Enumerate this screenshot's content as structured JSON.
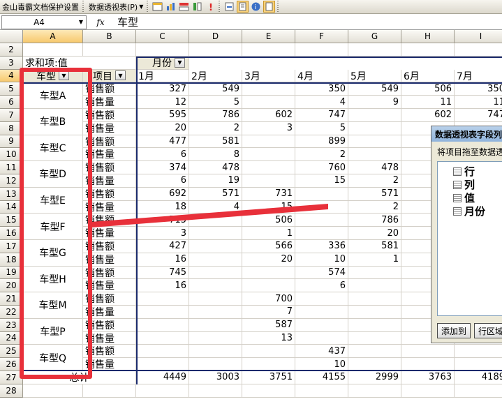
{
  "toolbar": {
    "protect_label": "金山毒霸文档保护设置",
    "pivot_menu_label": "数据透视表(P)",
    "icons": [
      "pivot-report-icon",
      "pivot-chart-icon",
      "insert-row-icon",
      "insert-col-icon",
      "error-icon",
      "refresh-icon",
      "field-list-icon",
      "info-icon",
      "hide-details-icon"
    ]
  },
  "formula_bar": {
    "cell_ref": "A4",
    "fx": "fx",
    "value": "车型"
  },
  "columns": [
    "A",
    "B",
    "C",
    "D",
    "E",
    "F",
    "G",
    "H",
    "I"
  ],
  "rows": [
    "2",
    "3",
    "4",
    "5",
    "6",
    "7",
    "8",
    "9",
    "10",
    "11",
    "12",
    "13",
    "14",
    "15",
    "16",
    "17",
    "18",
    "19",
    "20",
    "21",
    "22",
    "23",
    "24",
    "25",
    "26",
    "27",
    "28"
  ],
  "pivot": {
    "sum_label": "求和项:值",
    "month_field": "月份",
    "row_field": "车型",
    "item_field": "项目",
    "months": [
      "1月",
      "2月",
      "3月",
      "4月",
      "5月",
      "6月",
      "7月"
    ],
    "sales_amount": "销售额",
    "sales_qty": "销售量",
    "models": [
      {
        "name": "车型A",
        "amount": [
          "327",
          "549",
          "",
          "350",
          "549",
          "506",
          "350"
        ],
        "qty": [
          "12",
          "5",
          "",
          "4",
          "9",
          "11",
          "11"
        ]
      },
      {
        "name": "车型B",
        "amount": [
          "595",
          "786",
          "602",
          "747",
          "",
          "602",
          "747"
        ],
        "qty": [
          "20",
          "2",
          "3",
          "5",
          "",
          "",
          ""
        ]
      },
      {
        "name": "车型C",
        "amount": [
          "477",
          "581",
          "",
          "899",
          "",
          "",
          ""
        ],
        "qty": [
          "6",
          "8",
          "",
          "2",
          "",
          "",
          ""
        ]
      },
      {
        "name": "车型D",
        "amount": [
          "374",
          "478",
          "",
          "760",
          "478",
          "",
          ""
        ],
        "qty": [
          "6",
          "19",
          "",
          "15",
          "2",
          "",
          ""
        ]
      },
      {
        "name": "车型E",
        "amount": [
          "692",
          "571",
          "731",
          "",
          "571",
          "",
          ""
        ],
        "qty": [
          "18",
          "4",
          "15",
          "",
          "2",
          "",
          ""
        ]
      },
      {
        "name": "车型F",
        "amount": [
          "715",
          "",
          "506",
          "",
          "786",
          "",
          ""
        ],
        "qty": [
          "3",
          "",
          "1",
          "",
          "20",
          "",
          ""
        ]
      },
      {
        "name": "车型G",
        "amount": [
          "427",
          "",
          "566",
          "336",
          "581",
          "",
          ""
        ],
        "qty": [
          "16",
          "",
          "20",
          "10",
          "1",
          "",
          ""
        ]
      },
      {
        "name": "车型H",
        "amount": [
          "745",
          "",
          "",
          "574",
          "",
          "",
          ""
        ],
        "qty": [
          "16",
          "",
          "",
          "6",
          "",
          "",
          ""
        ]
      },
      {
        "name": "车型M",
        "amount": [
          "",
          "",
          "700",
          "",
          "",
          "",
          ""
        ],
        "qty": [
          "",
          "",
          "7",
          "",
          "",
          "",
          ""
        ]
      },
      {
        "name": "车型P",
        "amount": [
          "",
          "",
          "587",
          "",
          "",
          "",
          ""
        ],
        "qty": [
          "",
          "",
          "13",
          "",
          "",
          "",
          ""
        ]
      },
      {
        "name": "车型Q",
        "amount": [
          "",
          "",
          "",
          "437",
          "",
          "",
          ""
        ],
        "qty": [
          "",
          "",
          "",
          "10",
          "",
          "",
          ""
        ]
      }
    ],
    "total_label": "总计",
    "totals": [
      "4449",
      "3003",
      "3751",
      "4155",
      "2999",
      "3763",
      "4189"
    ]
  },
  "field_panel": {
    "title": "数据透视表字段列表",
    "hint": "将项目拖至数据透视表",
    "fields": [
      "行",
      "列",
      "值",
      "月份"
    ],
    "add_button": "添加到",
    "area_button": "行区域"
  },
  "highlight_color": "#e8303a"
}
